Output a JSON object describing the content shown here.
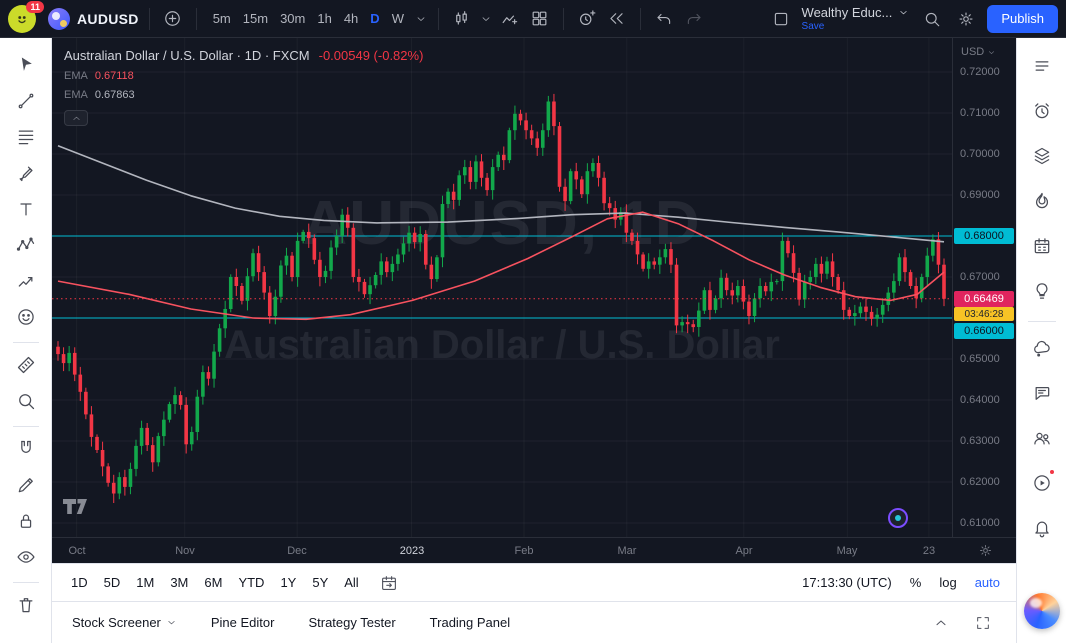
{
  "topbar": {
    "notifications_badge": "11",
    "symbol": "AUDUSD",
    "timeframes": [
      "5m",
      "15m",
      "30m",
      "1h",
      "4h",
      "D",
      "W"
    ],
    "active_timeframe": "D",
    "layout_name": "Wealthy Educ...",
    "save_label": "Save",
    "publish_label": "Publish"
  },
  "legend": {
    "title": "Australian Dollar / U.S. Dollar · 1D · FXCM",
    "change": "-0.00549 (-0.82%)",
    "indicators": [
      {
        "label": "EMA",
        "value": "0.67118",
        "color": "#f7525f"
      },
      {
        "label": "EMA",
        "value": "0.67863",
        "color": "#b2b5be"
      }
    ]
  },
  "watermark": {
    "line1": "AUDUSD, 1D",
    "line2": "Australian Dollar / U.S. Dollar"
  },
  "price_axis": {
    "currency": "USD",
    "ticks": [
      0.72,
      0.71,
      0.7,
      0.69,
      0.68,
      0.67,
      0.66,
      0.65,
      0.64,
      0.63,
      0.62,
      0.61
    ],
    "level_labels": [
      {
        "text": "0.68000",
        "price": 0.68,
        "offset": 0
      },
      {
        "text": "0.66000",
        "price": 0.66,
        "offset": 13
      }
    ],
    "last_price_label": {
      "text": "0.66469",
      "price": 0.66469,
      "countdown": "03:46:28"
    }
  },
  "time_axis": {
    "labels": [
      {
        "text": "Oct",
        "frac": 0.021
      },
      {
        "text": "Nov",
        "frac": 0.143
      },
      {
        "text": "Dec",
        "frac": 0.27
      },
      {
        "text": "2023",
        "frac": 0.399,
        "major": true
      },
      {
        "text": "Feb",
        "frac": 0.526
      },
      {
        "text": "Mar",
        "frac": 0.642
      },
      {
        "text": "Apr",
        "frac": 0.774
      },
      {
        "text": "May",
        "frac": 0.891
      },
      {
        "text": "23",
        "frac": 0.983
      }
    ]
  },
  "chart_data": {
    "type": "candlestick",
    "symbol": "AUDUSD",
    "interval": "1D",
    "exchange": "FXCM",
    "first_open": 0.653,
    "closes": [
      0.6512,
      0.649,
      0.6515,
      0.6462,
      0.642,
      0.6365,
      0.631,
      0.6278,
      0.6238,
      0.6198,
      0.6172,
      0.6212,
      0.6188,
      0.6232,
      0.6288,
      0.6332,
      0.629,
      0.6248,
      0.6312,
      0.6352,
      0.639,
      0.6412,
      0.6388,
      0.6292,
      0.6322,
      0.6408,
      0.6468,
      0.6452,
      0.6518,
      0.6575,
      0.6622,
      0.67,
      0.6678,
      0.6642,
      0.6702,
      0.6758,
      0.6712,
      0.6662,
      0.6605,
      0.6652,
      0.6728,
      0.6752,
      0.67,
      0.6788,
      0.681,
      0.6795,
      0.6742,
      0.67,
      0.6715,
      0.6772,
      0.68,
      0.6852,
      0.682,
      0.67,
      0.6688,
      0.6658,
      0.668,
      0.6705,
      0.6738,
      0.6712,
      0.6732,
      0.6755,
      0.6782,
      0.6808,
      0.6785,
      0.6805,
      0.673,
      0.6695,
      0.6748,
      0.6878,
      0.6908,
      0.6888,
      0.6948,
      0.6968,
      0.6932,
      0.6982,
      0.6942,
      0.6912,
      0.6968,
      0.6998,
      0.6985,
      0.7058,
      0.7098,
      0.7082,
      0.7058,
      0.7038,
      0.7015,
      0.7058,
      0.7128,
      0.7068,
      0.692,
      0.6885,
      0.6958,
      0.6938,
      0.6902,
      0.6958,
      0.6978,
      0.6942,
      0.688,
      0.6868,
      0.684,
      0.6858,
      0.6808,
      0.6788,
      0.6755,
      0.672,
      0.6738,
      0.673,
      0.6748,
      0.6768,
      0.673,
      0.6582,
      0.659,
      0.6585,
      0.6578,
      0.6618,
      0.6668,
      0.662,
      0.6648,
      0.6698,
      0.6668,
      0.6655,
      0.6678,
      0.664,
      0.6605,
      0.6648,
      0.6678,
      0.6665,
      0.6688,
      0.669,
      0.6788,
      0.6758,
      0.671,
      0.6645,
      0.6688,
      0.67,
      0.6732,
      0.6708,
      0.6738,
      0.67,
      0.6668,
      0.662,
      0.6605,
      0.6612,
      0.6628,
      0.6615,
      0.6598,
      0.6608,
      0.6632,
      0.6662,
      0.669,
      0.6748,
      0.6712,
      0.6678,
      0.6648,
      0.67,
      0.6752,
      0.6792,
      0.673,
      0.66469
    ],
    "ema_fast": {
      "label": "EMA",
      "value": 0.67118,
      "color": "#f7525f",
      "path": [
        [
          0,
          0.669
        ],
        [
          0.08,
          0.6658
        ],
        [
          0.15,
          0.6622
        ],
        [
          0.22,
          0.66
        ],
        [
          0.28,
          0.6597
        ],
        [
          0.33,
          0.6608
        ],
        [
          0.4,
          0.6643
        ],
        [
          0.47,
          0.669
        ],
        [
          0.53,
          0.6745
        ],
        [
          0.58,
          0.6798
        ],
        [
          0.62,
          0.6842
        ],
        [
          0.66,
          0.6858
        ],
        [
          0.7,
          0.683
        ],
        [
          0.74,
          0.6788
        ],
        [
          0.78,
          0.6742
        ],
        [
          0.82,
          0.6705
        ],
        [
          0.86,
          0.6675
        ],
        [
          0.9,
          0.6652
        ],
        [
          0.94,
          0.6643
        ],
        [
          0.97,
          0.6658
        ],
        [
          1,
          0.6712
        ]
      ]
    },
    "ema_slow": {
      "label": "EMA",
      "value": 0.67863,
      "color": "#b2b5be",
      "path": [
        [
          0,
          0.702
        ],
        [
          0.05,
          0.6978
        ],
        [
          0.1,
          0.6936
        ],
        [
          0.15,
          0.6898
        ],
        [
          0.2,
          0.6868
        ],
        [
          0.25,
          0.6848
        ],
        [
          0.3,
          0.6838
        ],
        [
          0.36,
          0.6832
        ],
        [
          0.44,
          0.6834
        ],
        [
          0.52,
          0.6843
        ],
        [
          0.58,
          0.6852
        ],
        [
          0.64,
          0.6856
        ],
        [
          0.7,
          0.6846
        ],
        [
          0.76,
          0.6833
        ],
        [
          0.82,
          0.6821
        ],
        [
          0.88,
          0.681
        ],
        [
          0.94,
          0.6798
        ],
        [
          1,
          0.6786
        ]
      ]
    },
    "levels": [
      0.68,
      0.66
    ],
    "last_price": 0.66469,
    "price_range_top": 0.7283,
    "price_range_bottom": 0.6066
  },
  "range_bar": {
    "ranges": [
      "1D",
      "5D",
      "1M",
      "3M",
      "6M",
      "YTD",
      "1Y",
      "5Y",
      "All"
    ],
    "clock": "17:13:30 (UTC)",
    "scale_percent": "%",
    "scale_log": "log",
    "scale_auto": "auto",
    "active_scale": "auto"
  },
  "bottom_panels": [
    {
      "label": "Stock Screener",
      "has_caret": true
    },
    {
      "label": "Pine Editor",
      "has_caret": false
    },
    {
      "label": "Strategy Tester",
      "has_caret": false
    },
    {
      "label": "Trading Panel",
      "has_caret": false
    }
  ],
  "left_toolbar": [
    [
      "cursor",
      "trend-line",
      "fib-retracement",
      "brush",
      "text",
      "xabcd-pattern",
      "forecast",
      "emoji"
    ],
    [
      "measure",
      "zoom"
    ],
    [
      "magnet",
      "edit",
      "lock",
      "eye"
    ],
    [
      "trash"
    ]
  ],
  "right_sidebar": [
    [
      "watchlist",
      "alerts",
      "news",
      "hotlists",
      "calendar",
      "ideas"
    ],
    [
      "minds",
      "chat",
      "people",
      "streams",
      "notifications"
    ]
  ],
  "colors": {
    "up": "#12a84b",
    "down": "#f23645",
    "accent": "#2962ff",
    "cyan": "#00bcd4",
    "last_label_bg": "#e0245e",
    "countdown_bg": "#f7c325",
    "background": "#131722"
  }
}
